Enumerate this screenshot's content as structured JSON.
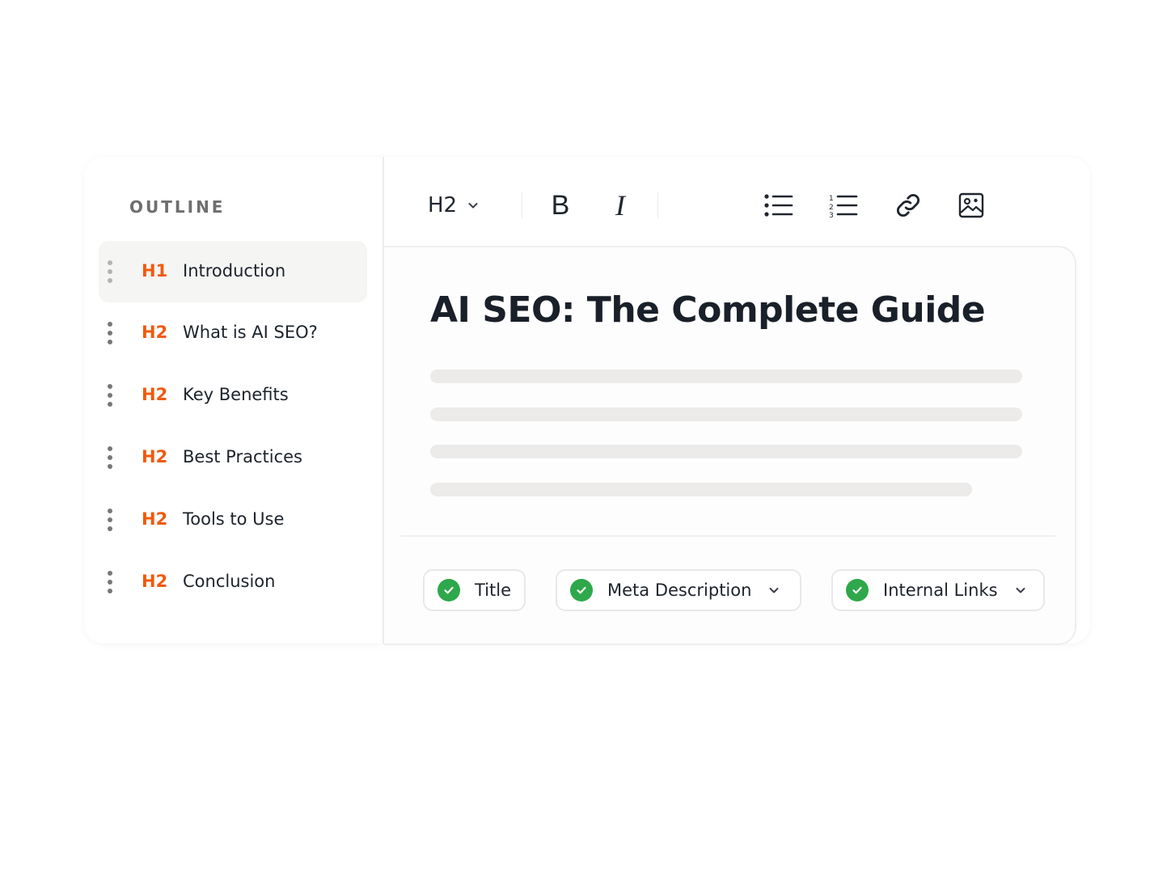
{
  "sidebar": {
    "title": "OUTLINE",
    "items": [
      {
        "level": "H1",
        "label": "Introduction",
        "active": true
      },
      {
        "level": "H2",
        "label": "What is AI SEO?"
      },
      {
        "level": "H2",
        "label": "Key Benefits"
      },
      {
        "level": "H2",
        "label": "Best Practices"
      },
      {
        "level": "H2",
        "label": "Tools to Use"
      },
      {
        "level": "H2",
        "label": "Conclusion"
      }
    ]
  },
  "toolbar": {
    "heading_select": "H2",
    "bold": "B",
    "italic": "I",
    "icons": [
      "chevron-down-icon",
      "bullet-list-icon",
      "numbered-list-icon",
      "link-icon",
      "image-icon"
    ]
  },
  "editor": {
    "title": "AI SEO: The Complete Guide"
  },
  "checks": [
    {
      "label": "Title",
      "status": "passed"
    },
    {
      "label": "Meta Description",
      "status": "passed",
      "expandable": true
    },
    {
      "label": "Internal Links",
      "status": "passed",
      "expandable": true
    }
  ],
  "colors": {
    "accent": "#f05a0e",
    "success": "#2ea84a",
    "text": "#1d232b",
    "muted": "#6f6f6f",
    "placeholder_line": "#ecebea"
  }
}
